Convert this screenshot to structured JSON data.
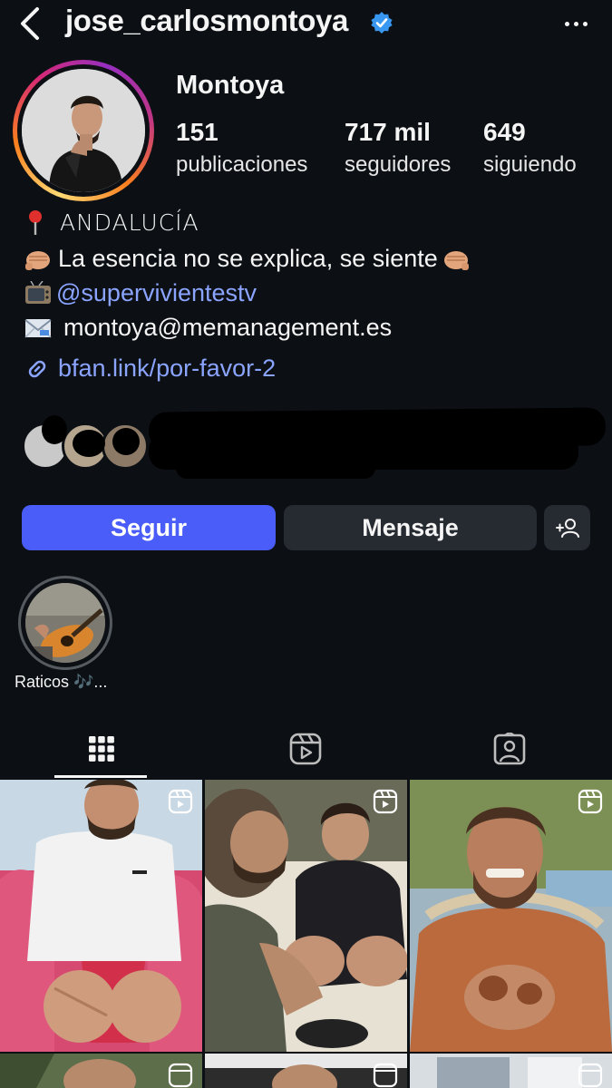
{
  "header": {
    "username": "jose_carlosmontoya",
    "verified": true,
    "back_icon": "chevron-left-icon",
    "more_icon": "more-horizontal-icon"
  },
  "profile": {
    "display_name": "Montoya",
    "stats": [
      {
        "value": "151",
        "label": "publicaciones"
      },
      {
        "value": "717 mil",
        "label": "seguidores"
      },
      {
        "value": "649",
        "label": "siguiendo"
      }
    ],
    "bio": {
      "location": "ANDALUCÍA",
      "tagline": "La esencia no se explica, se siente",
      "mention": "@supervivientestv",
      "email": "montoya@memanagement.es",
      "link": "bfan.link/por-favor-2"
    }
  },
  "actions": {
    "follow_label": "Seguir",
    "message_label": "Mensaje",
    "add_user_icon": "person-add-icon"
  },
  "highlights": [
    {
      "label": "Raticos 🎶..."
    }
  ],
  "tabs": [
    {
      "name": "posts",
      "icon": "grid-icon",
      "active": true
    },
    {
      "name": "reels",
      "icon": "reels-icon",
      "active": false
    },
    {
      "name": "tagged",
      "icon": "tagged-icon",
      "active": false
    }
  ],
  "colors": {
    "background": "#0c1014",
    "follow_button": "#4a5df9",
    "secondary_button": "#262a31",
    "link": "#8aa4ff",
    "verified": "#3897f0"
  }
}
